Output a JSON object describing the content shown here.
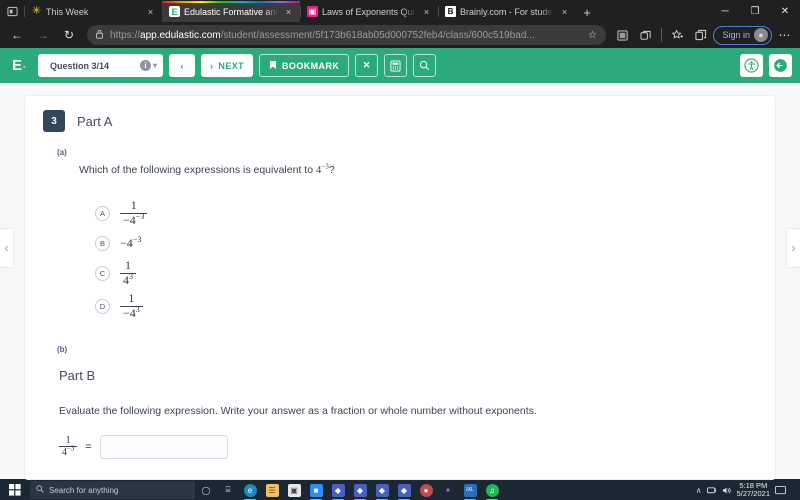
{
  "browser": {
    "tabs": [
      {
        "title": "This Week",
        "favicon": "sun-icon",
        "active": false
      },
      {
        "title": "Edulastic Formative and Summa",
        "favicon": "edulastic-icon",
        "active": true
      },
      {
        "title": "Laws of Exponents Quiz",
        "favicon": "quiz-icon",
        "active": false
      },
      {
        "title": "Brainly.com - For students. By st",
        "favicon": "brainly-icon",
        "active": false
      }
    ],
    "new_tab_label": "+",
    "tab_close_label": "×",
    "window_controls": {
      "minimize": "─",
      "maximize": "❐",
      "close": "✕"
    },
    "nav": {
      "back": "←",
      "forward": "→",
      "refresh": "↻"
    },
    "url": {
      "lock": "🔒",
      "scheme": "https://",
      "host": "app.edulastic.com",
      "path": "/student/assessment/5f173b618ab05d000752feb4/class/600c519bad..."
    },
    "toolbar": {
      "favorite": "☆",
      "collections": "⧉",
      "signin_label": "Sign in",
      "settings_label": "⋯"
    }
  },
  "appbar": {
    "logo": "E",
    "logo_dot": "·",
    "question_selector": "Question 3/14",
    "info_badge": "i",
    "prev_label": "‹",
    "next_label": "NEXT",
    "next_arrow": "›",
    "bookmark_label": "BOOKMARK",
    "bookmark_icon": "🔖",
    "close_icon": "✕",
    "calculator_icon": "calculator-icon",
    "search_icon": "🔍",
    "accessibility_icon": "accessibility-icon",
    "exit_icon": "exit-icon"
  },
  "navigation": {
    "prev_question": "‹",
    "next_question": "›"
  },
  "question": {
    "number": "3",
    "part_a": {
      "title": "Part A",
      "sub_label": "(a)",
      "stem_prefix": "Which of the following expressions is equivalent to ",
      "stem_base": "4",
      "stem_exponent": "−3",
      "stem_suffix": "?",
      "choices": [
        {
          "letter": "A",
          "type": "fraction",
          "numerator": "1",
          "denominator_base": "−4",
          "denominator_exponent": "−3"
        },
        {
          "letter": "B",
          "type": "plain",
          "base": "−4",
          "exponent": "−3"
        },
        {
          "letter": "C",
          "type": "fraction",
          "numerator": "1",
          "denominator_base": "4",
          "denominator_exponent": "3"
        },
        {
          "letter": "D",
          "type": "fraction",
          "numerator": "1",
          "denominator_base": "−4",
          "denominator_exponent": "3"
        }
      ]
    },
    "part_b": {
      "sub_label": "(b)",
      "title": "Part B",
      "prompt": "Evaluate the following expression. Write your answer as a fraction or whole number without exponents.",
      "expression": {
        "numerator": "1",
        "denominator_base": "4",
        "denominator_exponent": "−3"
      },
      "equals": "=",
      "answer_value": "",
      "answer_placeholder": ""
    }
  },
  "taskbar": {
    "start_icon": "windows-icon",
    "search_icon": "🔍",
    "search_placeholder": "Search for anything",
    "task_view": "◯",
    "task_view2": "⌸",
    "apps": [
      {
        "name": "edge-icon",
        "glyph": "e",
        "color": "#1b8ac1",
        "running": true
      },
      {
        "name": "file-explorer-icon",
        "glyph": "☰",
        "color": "#f0bf5f",
        "running": false
      },
      {
        "name": "microsoft-store-icon",
        "glyph": "▣",
        "color": "#e7e7e7",
        "running": false
      },
      {
        "name": "zoom-icon",
        "glyph": "■",
        "color": "#2d8cff",
        "running": true
      },
      {
        "name": "game-icon-1",
        "glyph": "◆",
        "color": "#4a5fc1",
        "running": true
      },
      {
        "name": "game-icon-2",
        "glyph": "◆",
        "color": "#4a5fc1",
        "running": true
      },
      {
        "name": "game-icon-3",
        "glyph": "◆",
        "color": "#4a5fc1",
        "running": true
      },
      {
        "name": "game-icon-4",
        "glyph": "◆",
        "color": "#4a5fc1",
        "running": true
      },
      {
        "name": "avatar-app-icon",
        "glyph": "●",
        "color": "#c34a4a",
        "running": false
      },
      {
        "name": "purple-app-icon",
        "glyph": "✦",
        "color": "#8b3fa8",
        "running": false
      },
      {
        "name": "ixl-icon",
        "glyph": "IXL",
        "color": "#2a6ebb",
        "running": true
      },
      {
        "name": "spotify-icon",
        "glyph": "♫",
        "color": "#1db954",
        "running": true
      }
    ],
    "tray": {
      "chevron": "∧",
      "network_icon": "🖧",
      "volume_icon": "🔊",
      "time": "5:18 PM",
      "date": "5/27/2021",
      "notification_icon": "💬"
    }
  }
}
